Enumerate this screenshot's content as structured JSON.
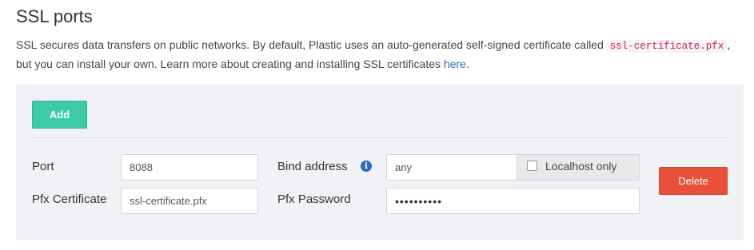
{
  "header": {
    "title": "SSL ports",
    "desc_part1": "SSL secures data transfers on public networks. By default, Plastic uses an auto-generated self-signed certificate called ",
    "desc_code": "ssl-certificate.pfx",
    "desc_part2": ", but you can install your own. Learn more about creating and installing SSL certificates ",
    "desc_link": "here",
    "desc_end": "."
  },
  "panel": {
    "add_label": "Add",
    "delete_label": "Delete",
    "port": {
      "label": "Port",
      "value": "8088"
    },
    "bind": {
      "label": "Bind address",
      "value": "any",
      "info_icon": "info-icon",
      "localhost_label": "Localhost only",
      "localhost_checked": false
    },
    "pfx_cert": {
      "label": "Pfx Certificate",
      "value": "ssl-certificate.pfx"
    },
    "pfx_password": {
      "label": "Pfx Password",
      "value": "••••••••••"
    }
  },
  "colors": {
    "add": "#3ccba4",
    "delete": "#e9503a",
    "panel": "#f0f2f5",
    "link": "#2a6fb6"
  }
}
